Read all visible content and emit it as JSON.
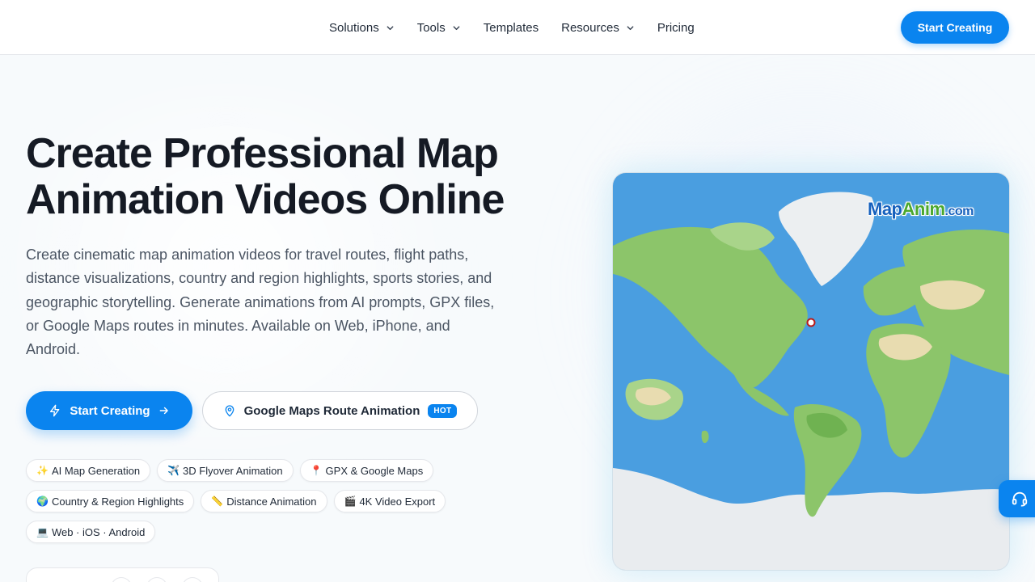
{
  "nav": {
    "items": [
      {
        "label": "Solutions",
        "has_dropdown": true
      },
      {
        "label": "Tools",
        "has_dropdown": true
      },
      {
        "label": "Templates",
        "has_dropdown": false
      },
      {
        "label": "Resources",
        "has_dropdown": true
      },
      {
        "label": "Pricing",
        "has_dropdown": false
      }
    ],
    "cta_label": "Start Creating"
  },
  "hero": {
    "title_line1": "Create Professional Map",
    "title_line2": "Animation Videos Online",
    "description": "Create cinematic map animation videos for travel routes, flight paths, distance visualizations, country and region highlights, sports stories, and geographic storytelling. Generate animations from AI prompts, GPX files, or Google Maps routes in minutes. Available on Web, iPhone, and Android.",
    "primary_button": {
      "label": "Start Creating",
      "icon": "lightning-icon",
      "trailing_icon": "arrow-right-icon"
    },
    "secondary_button": {
      "label": "Google Maps Route Animation",
      "icon": "map-pin-icon",
      "badge": "HOT"
    }
  },
  "features": [
    [
      {
        "emoji": "✨",
        "label": "AI Map Generation"
      },
      {
        "emoji": "✈️",
        "label": "3D Flyover Animation"
      },
      {
        "emoji": "📍",
        "label": "GPX & Google Maps"
      }
    ],
    [
      {
        "emoji": "🌍",
        "label": "Country & Region Highlights"
      },
      {
        "emoji": "📏",
        "label": "Distance Animation"
      },
      {
        "emoji": "🎬",
        "label": "4K Video Export"
      }
    ],
    [
      {
        "emoji": "💻",
        "label": "Web · iOS · Android"
      }
    ]
  ],
  "map_preview": {
    "logo_main": "Map",
    "logo_accent": "Anim",
    "logo_suffix": ".com"
  },
  "colors": {
    "brand": "#0a84ef",
    "ocean": "#4a9ee0",
    "land": "#8cc56a",
    "ice": "#e9ecef"
  },
  "support_icon": "headset-icon"
}
